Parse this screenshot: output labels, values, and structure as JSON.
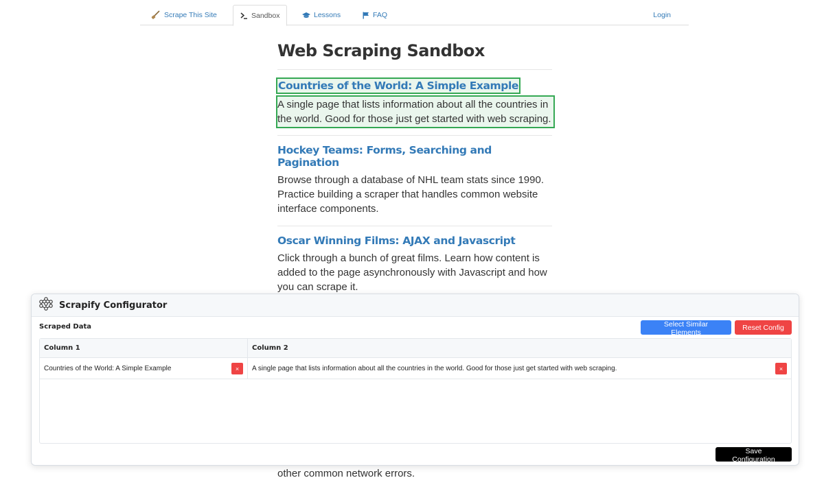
{
  "nav": {
    "brand_label": "Scrape This Site",
    "sandbox_label": "Sandbox",
    "lessons_label": "Lessons",
    "faq_label": "FAQ",
    "login_label": "Login"
  },
  "page": {
    "title": "Web Scraping Sandbox",
    "items": [
      {
        "title": "Countries of the World: A Simple Example",
        "description": "A single page that lists information about all the countries in the world. Good for those just get started with web scraping."
      },
      {
        "title": "Hockey Teams: Forms, Searching and Pagination",
        "description": "Browse through a database of NHL team stats since 1990. Practice building a scraper that handles common website interface components."
      },
      {
        "title": "Oscar Winning Films: AJAX and Javascript",
        "description": "Click through a bunch of great films. Learn how content is added to the page asynchronously with Javascript and how you can scrape it."
      }
    ],
    "partial_text": "other common network errors."
  },
  "configurator": {
    "title": "Scrapify Configurator",
    "scraped_data_label": "Scraped Data",
    "select_similar_label": "Select Similar Elements",
    "reset_label": "Reset Config",
    "save_label": "Save Configuration",
    "delete_glyph": "×",
    "columns": [
      "Column 1",
      "Column 2"
    ],
    "rows": [
      [
        "Countries of the World: A Simple Example",
        "A single page that lists information about all the countries in the world. Good for those just get started with web scraping."
      ]
    ]
  },
  "colors": {
    "link": "#337ab7",
    "highlight": "#34a853",
    "primary_button": "#3b82f6",
    "danger_button": "#ef4444",
    "save_button": "#000000"
  }
}
